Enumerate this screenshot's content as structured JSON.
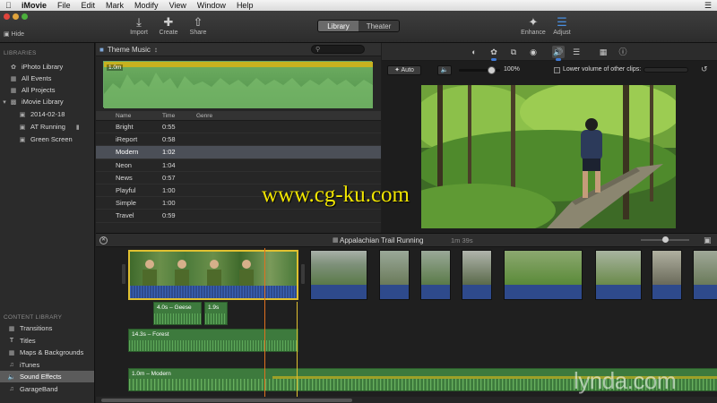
{
  "menubar": {
    "app": "iMovie",
    "items": [
      "File",
      "Edit",
      "Mark",
      "Modify",
      "View",
      "Window",
      "Help"
    ]
  },
  "toolbar": {
    "hide": "Hide",
    "import": "Import",
    "create": "Create",
    "share": "Share",
    "library": "Library",
    "theater": "Theater",
    "enhance": "Enhance",
    "adjust": "Adjust",
    "active_view": "Library"
  },
  "sidebar": {
    "libraries_heading": "LIBRARIES",
    "libraries": [
      {
        "label": "iPhoto Library",
        "icon": "photo-icon"
      },
      {
        "label": "All Events",
        "icon": "events-icon"
      },
      {
        "label": "All Projects",
        "icon": "projects-icon"
      },
      {
        "label": "iMovie Library",
        "icon": "library-icon"
      },
      {
        "label": "2014-02-18",
        "icon": "event-icon"
      },
      {
        "label": "AT Running",
        "icon": "event-icon"
      },
      {
        "label": "Green Screen",
        "icon": "event-icon"
      }
    ],
    "content_heading": "CONTENT LIBRARY",
    "content": [
      {
        "label": "Transitions",
        "icon": "transitions-icon"
      },
      {
        "label": "Titles",
        "icon": "titles-icon"
      },
      {
        "label": "Maps & Backgrounds",
        "icon": "maps-icon"
      },
      {
        "label": "iTunes",
        "icon": "itunes-icon"
      },
      {
        "label": "Sound Effects",
        "icon": "sound-effects-icon"
      },
      {
        "label": "GarageBand",
        "icon": "garageband-icon"
      }
    ],
    "selected": "Sound Effects"
  },
  "browser": {
    "title": "Theme Music",
    "waveform_tag": "1.0m",
    "columns": [
      "Name",
      "Time",
      "Genre"
    ],
    "rows": [
      {
        "name": "Bright",
        "time": "0:55",
        "genre": ""
      },
      {
        "name": "iReport",
        "time": "0:58",
        "genre": ""
      },
      {
        "name": "Modern",
        "time": "1:02",
        "genre": ""
      },
      {
        "name": "Neon",
        "time": "1:04",
        "genre": ""
      },
      {
        "name": "News",
        "time": "0:57",
        "genre": ""
      },
      {
        "name": "Playful",
        "time": "1:00",
        "genre": ""
      },
      {
        "name": "Simple",
        "time": "1:00",
        "genre": ""
      },
      {
        "name": "Travel",
        "time": "0:59",
        "genre": ""
      }
    ],
    "selected_row": "Modern"
  },
  "viewer": {
    "auto": "Auto",
    "volume_pct": "100%",
    "volume_level": 1.0,
    "lower_volume_label": "Lower volume of other clips:"
  },
  "timeline": {
    "project": "Appalachian Trail Running",
    "duration": "1m 39s",
    "sfx": [
      {
        "label": "4.0s – Geese"
      },
      {
        "label": "1.9s"
      },
      {
        "label": "14.3s – Forest"
      }
    ],
    "music": "1.0m – Modern"
  },
  "watermarks": {
    "cgku": "www.cg-ku.com",
    "lynda": "lynda.com"
  },
  "colors": {
    "accent_blue": "#3f7ad6",
    "selection_yellow": "#e0c030",
    "playhead": "#e07020",
    "audio_green": "#3d7a3d"
  }
}
